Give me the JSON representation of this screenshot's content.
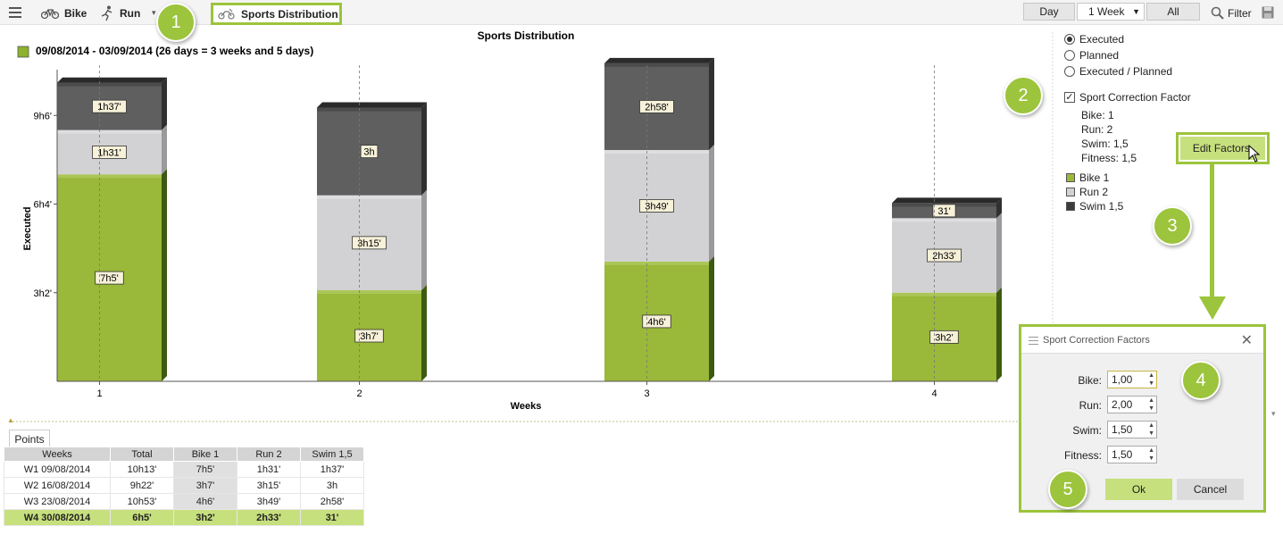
{
  "toolbar": {
    "items": [
      {
        "label": "Bike",
        "icon": "bike-icon"
      },
      {
        "label": "Run",
        "icon": "run-icon"
      }
    ],
    "active_tab": "Sports Distribution",
    "period": {
      "day": "Day",
      "range": "1 Week",
      "all": "All"
    },
    "filter": "Filter"
  },
  "chart_data": {
    "type": "bar",
    "stacked": true,
    "title": "Sports Distribution",
    "subtitle": "09/08/2014 - 03/09/2014 (26 days = 3 weeks and 5 days)",
    "xlabel": "Weeks",
    "ylabel": "Executed",
    "categories": [
      "1",
      "2",
      "3",
      "4"
    ],
    "y_ticks": [
      {
        "label": "3h2'",
        "minutes": 182
      },
      {
        "label": "6h4'",
        "minutes": 364
      },
      {
        "label": "9h6'",
        "minutes": 546
      }
    ],
    "ylim_minutes": [
      0,
      640
    ],
    "series": [
      {
        "key": "bike",
        "values_minutes": [
          425,
          187,
          246,
          182
        ],
        "labels": [
          "7h5'",
          "3h7'",
          "4h6'",
          "3h2'"
        ],
        "color": "#9ab83a"
      },
      {
        "key": "run",
        "values_minutes": [
          91,
          195,
          229,
          153
        ],
        "labels": [
          "1h31'",
          "3h15'",
          "3h49'",
          "2h33'"
        ],
        "color": "#d2d2d4"
      },
      {
        "key": "swim",
        "values_minutes": [
          97,
          180,
          178,
          31
        ],
        "labels": [
          "1h37'",
          "3h",
          "2h58'",
          "31'"
        ],
        "color": "#5f5f60"
      }
    ],
    "grid": "vertical-dashed"
  },
  "side_panel": {
    "mode_options": [
      "Executed",
      "Planned",
      "Executed / Planned"
    ],
    "mode_selected": 0,
    "correction_label": "Sport Correction Factor",
    "correction_checked": true,
    "factors": [
      "Bike: 1",
      "Run: 2",
      "Swim: 1,5",
      "Fitness: 1,5"
    ],
    "edit_button": "Edit Factors.",
    "legend": [
      {
        "label": "Bike 1",
        "color": "#9ab83a"
      },
      {
        "label": "Run 2",
        "color": "#d2d2d4"
      },
      {
        "label": "Swim 1,5",
        "color": "#3c3c3c"
      }
    ]
  },
  "points": {
    "tab_label": "Points",
    "columns": [
      "Weeks",
      "Total",
      "Bike 1",
      "Run 2",
      "Swim 1,5"
    ],
    "rows": [
      [
        "W1 09/08/2014",
        "10h13'",
        "7h5'",
        "1h31'",
        "1h37'"
      ],
      [
        "W2 16/08/2014",
        "9h22'",
        "3h7'",
        "3h15'",
        "3h"
      ],
      [
        "W3 23/08/2014",
        "10h53'",
        "4h6'",
        "3h49'",
        "2h58'"
      ],
      [
        "W4 30/08/2014",
        "6h5'",
        "3h2'",
        "2h33'",
        "31'"
      ]
    ]
  },
  "dialog": {
    "title": "Sport Correction Factors",
    "fields": [
      {
        "label": "Bike:",
        "value": "1,00"
      },
      {
        "label": "Run:",
        "value": "2,00"
      },
      {
        "label": "Swim:",
        "value": "1,50"
      },
      {
        "label": "Fitness:",
        "value": "1,50"
      }
    ],
    "ok": "Ok",
    "cancel": "Cancel"
  },
  "callouts": [
    "1",
    "2",
    "3",
    "4",
    "5"
  ]
}
